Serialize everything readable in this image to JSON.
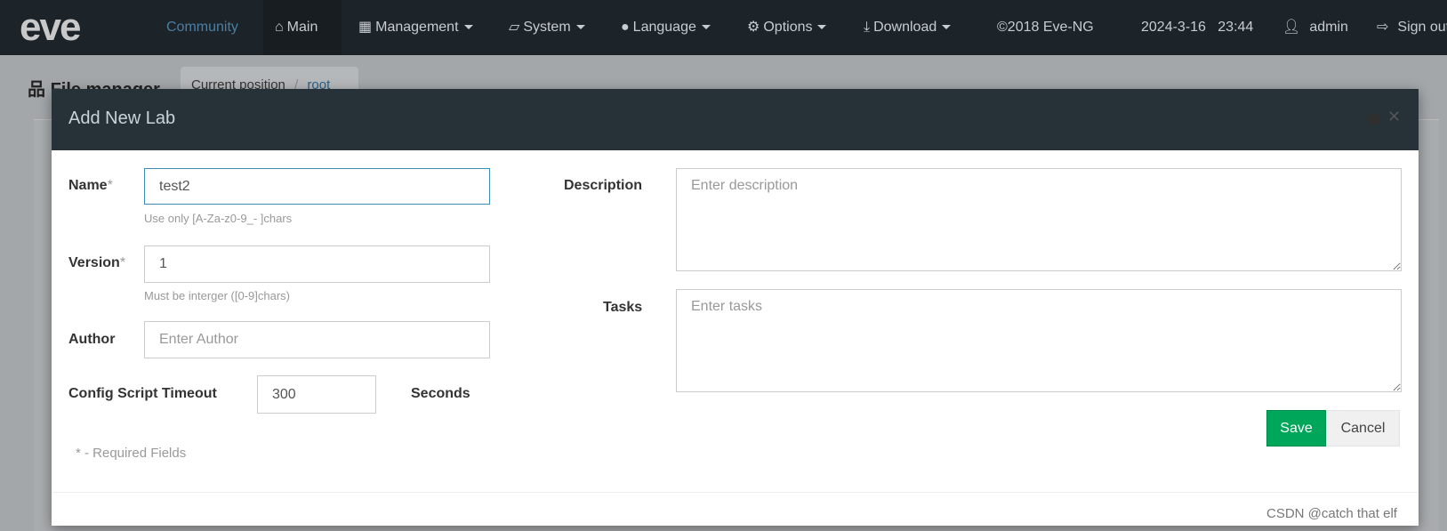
{
  "navbar": {
    "logo": "eve",
    "items": [
      {
        "label": "Community"
      },
      {
        "label": "Main",
        "icon": "home-icon"
      },
      {
        "label": "Management",
        "icon": "grid-icon"
      },
      {
        "label": "System",
        "icon": "book-icon"
      },
      {
        "label": "Language",
        "icon": "globe-icon"
      },
      {
        "label": "Options",
        "icon": "gear-icon"
      },
      {
        "label": "Download",
        "icon": "download-icon"
      }
    ],
    "copyright": "©2018 Eve-NG",
    "datetime": "2024-3-16   23:44",
    "user": "admin",
    "signout": "Sign out"
  },
  "page": {
    "title": "File manager",
    "breadcrumb_label": "Current position",
    "breadcrumb_sep": "/",
    "breadcrumb_root": "root"
  },
  "modal": {
    "title": "Add New Lab",
    "name": {
      "label": "Name",
      "req": "*",
      "value": "test2",
      "help": "Use only [A-Za-z0-9_- ]chars"
    },
    "version": {
      "label": "Version",
      "req": "*",
      "value": "1",
      "help": "Must be interger ([0-9]chars)"
    },
    "author": {
      "label": "Author",
      "placeholder": "Enter Author"
    },
    "timeout": {
      "label": "Config Script Timeout",
      "value": "300",
      "unit": "Seconds"
    },
    "required_note": "* - Required Fields",
    "description": {
      "label": "Description",
      "placeholder": "Enter description"
    },
    "tasks": {
      "label": "Tasks",
      "placeholder": "Enter tasks"
    },
    "save": "Save",
    "cancel": "Cancel"
  },
  "watermark": "CSDN @catch that elf",
  "colors": {
    "navbar": "#1c2329",
    "modal_header": "#263238",
    "save": "#00a65a",
    "focus": "#3c8dbc"
  }
}
